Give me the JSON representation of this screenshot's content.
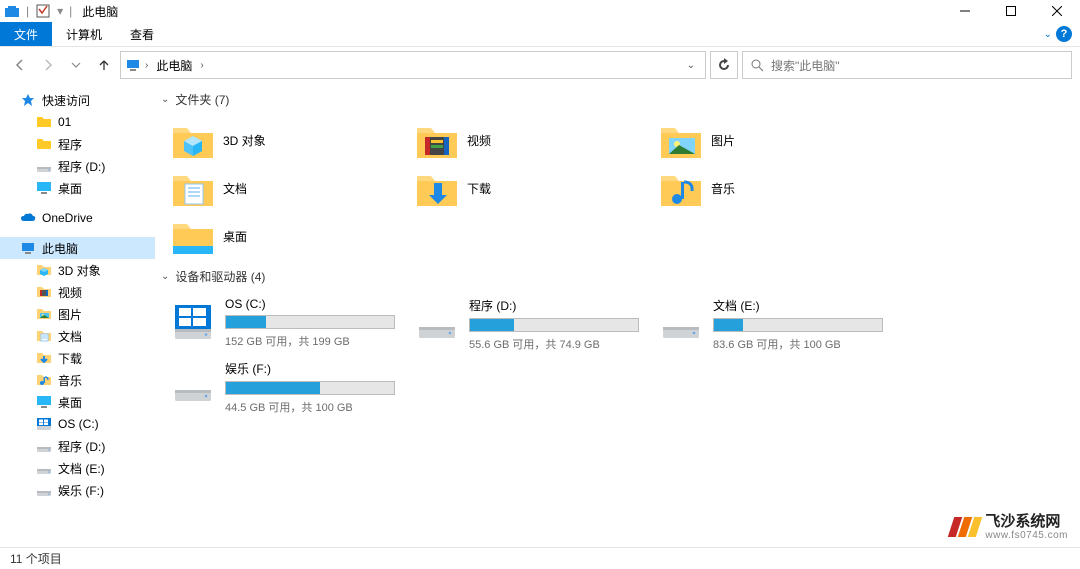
{
  "title": "此电脑",
  "ribbon": {
    "file": "文件",
    "computer": "计算机",
    "view": "查看",
    "help": "?"
  },
  "nav": {
    "location": "此电脑",
    "search_placeholder": "搜索\"此电脑\""
  },
  "sidebar": {
    "quick": "快速访问",
    "quick_items": [
      {
        "label": "01",
        "icon": "folder"
      },
      {
        "label": "程序",
        "icon": "folder"
      },
      {
        "label": "程序 (D:)",
        "icon": "drive"
      },
      {
        "label": "桌面",
        "icon": "desktop"
      }
    ],
    "onedrive": "OneDrive",
    "thispc": "此电脑",
    "pc_items": [
      {
        "label": "3D 对象",
        "icon": "3d"
      },
      {
        "label": "视频",
        "icon": "video"
      },
      {
        "label": "图片",
        "icon": "pictures"
      },
      {
        "label": "文档",
        "icon": "documents"
      },
      {
        "label": "下载",
        "icon": "downloads"
      },
      {
        "label": "音乐",
        "icon": "music"
      },
      {
        "label": "桌面",
        "icon": "desktop"
      },
      {
        "label": "OS (C:)",
        "icon": "windrive"
      },
      {
        "label": "程序 (D:)",
        "icon": "drive"
      },
      {
        "label": "文档 (E:)",
        "icon": "drive"
      },
      {
        "label": "娱乐 (F:)",
        "icon": "drive"
      }
    ]
  },
  "groups": {
    "folders_header": "文件夹 (7)",
    "folders": [
      {
        "label": "3D 对象",
        "icon": "3d"
      },
      {
        "label": "视频",
        "icon": "video"
      },
      {
        "label": "图片",
        "icon": "pictures"
      },
      {
        "label": "文档",
        "icon": "documents"
      },
      {
        "label": "下载",
        "icon": "downloads"
      },
      {
        "label": "音乐",
        "icon": "music"
      },
      {
        "label": "桌面",
        "icon": "desktop"
      }
    ],
    "drives_header": "设备和驱动器 (4)",
    "drives": [
      {
        "label": "OS (C:)",
        "info": "152 GB 可用，共 199 GB",
        "fill": 24
      },
      {
        "label": "程序 (D:)",
        "info": "55.6 GB 可用，共 74.9 GB",
        "fill": 26
      },
      {
        "label": "文档 (E:)",
        "info": "83.6 GB 可用，共 100 GB",
        "fill": 17
      },
      {
        "label": "娱乐 (F:)",
        "info": "44.5 GB 可用，共 100 GB",
        "fill": 56
      }
    ]
  },
  "status": "11 个项目",
  "watermark": {
    "cn": "飞沙系统网",
    "url": "www.fs0745.com"
  }
}
